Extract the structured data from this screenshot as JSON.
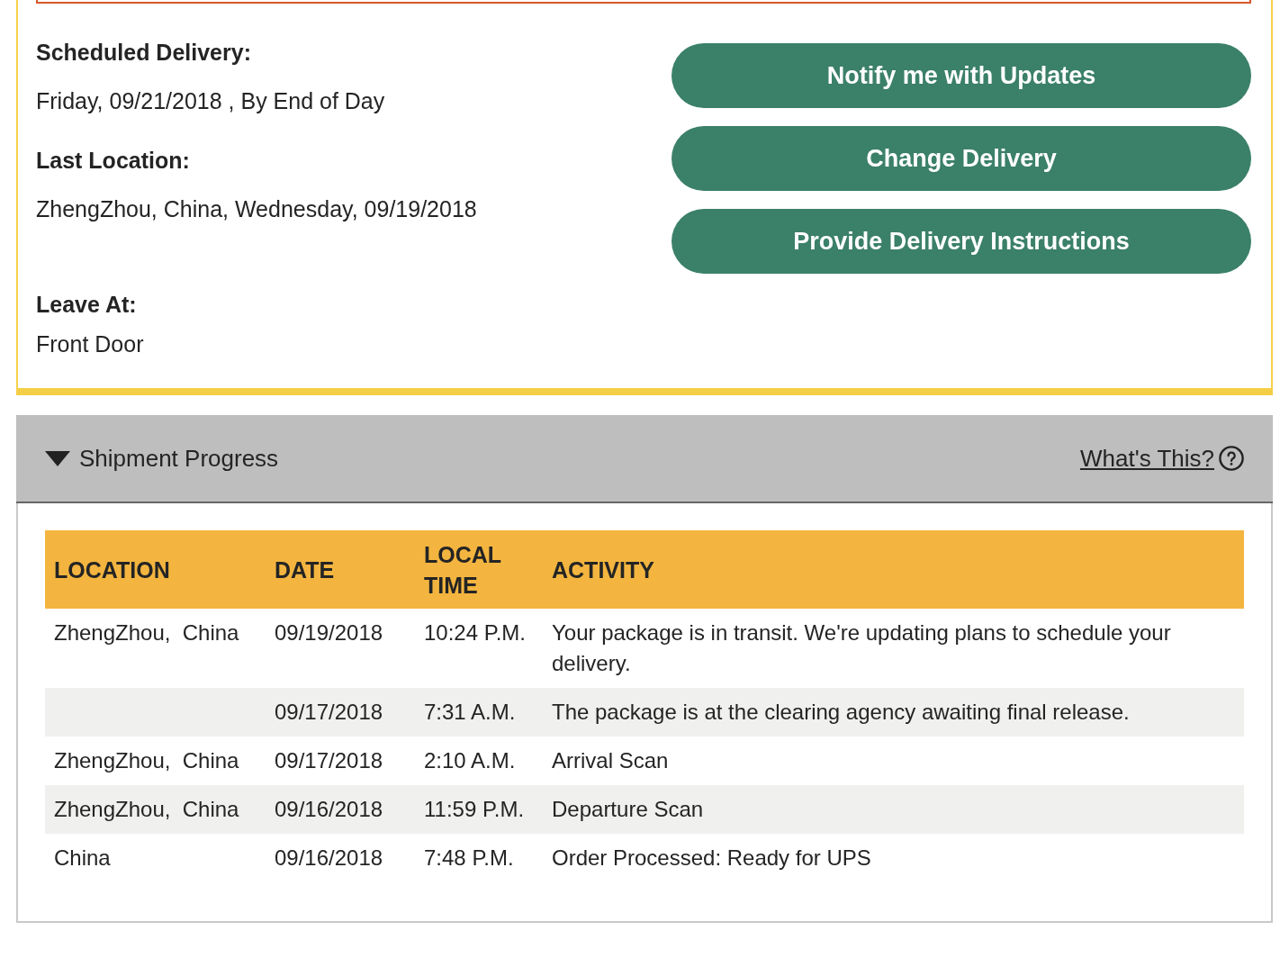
{
  "delivery_details": [
    {
      "label": "Scheduled Delivery:",
      "value": "Friday, 09/21/2018 , By End of Day"
    },
    {
      "label": "Last Location:",
      "value": "ZhengZhou, China, Wednesday, 09/19/2018"
    },
    {
      "label": "Leave At:",
      "value": "Front Door"
    }
  ],
  "actions": [
    "Notify me with Updates",
    "Change Delivery",
    "Provide Delivery Instructions"
  ],
  "shipment_progress": {
    "title": "Shipment Progress",
    "expanded": true,
    "help_link": "What's This?",
    "table": {
      "columns": [
        "LOCATION",
        "DATE",
        "LOCAL TIME",
        "ACTIVITY"
      ],
      "rows": [
        {
          "location": "ZhengZhou,  China",
          "date": "09/19/2018",
          "time": "10:24 P.M.",
          "activity": "Your package is in transit. We're updating plans to schedule your delivery."
        },
        {
          "date": "09/17/2018",
          "time": "7:31 A.M.",
          "activity": "The package is at the clearing agency awaiting final release."
        },
        {
          "location": "ZhengZhou,  China",
          "date": "09/17/2018",
          "time": "2:10 A.M.",
          "activity": "Arrival Scan"
        },
        {
          "location": "ZhengZhou,  China",
          "date": "09/16/2018",
          "time": "11:59 P.M.",
          "activity": "Departure Scan"
        },
        {
          "location": "China",
          "date": "09/16/2018",
          "time": "7:48 P.M.",
          "activity": "Order Processed: Ready for UPS"
        }
      ]
    }
  }
}
